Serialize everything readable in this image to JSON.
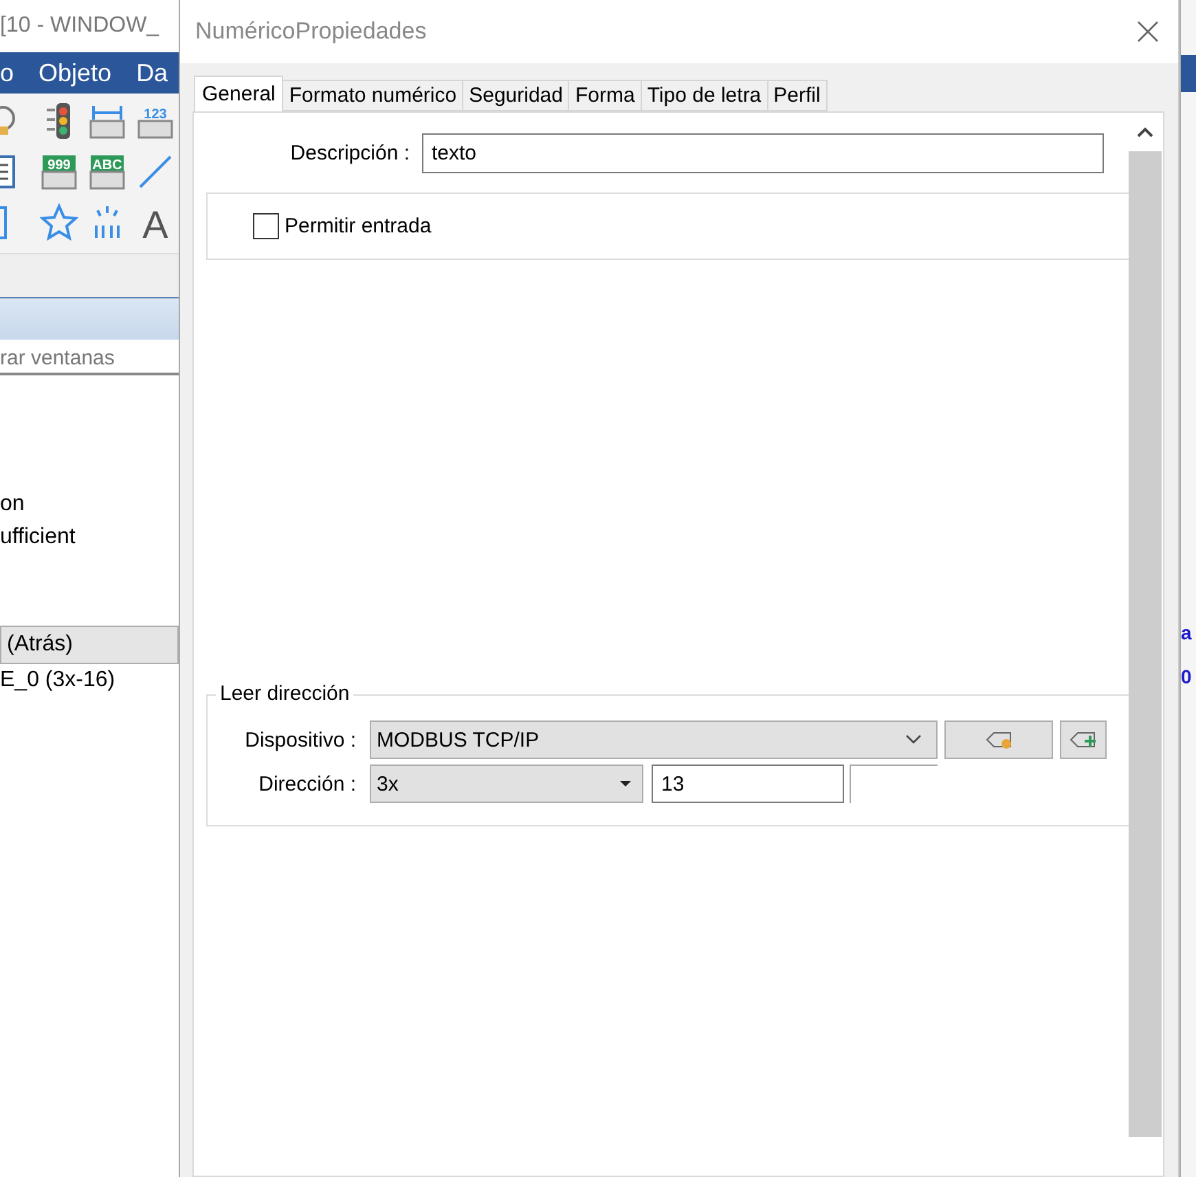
{
  "background_app": {
    "title": "[10 - WINDOW_",
    "menu": [
      "o",
      "Objeto",
      "Da"
    ],
    "toolbar": [
      [
        {
          "kind": "bulb"
        },
        {
          "kind": "traffic"
        },
        {
          "kind": "bar"
        },
        {
          "kind": "num",
          "label": "123"
        }
      ],
      [
        {
          "kind": "list"
        },
        {
          "kind": "numgreen",
          "label": "999"
        },
        {
          "kind": "numgreen",
          "label": "ABC"
        },
        {
          "kind": "line"
        }
      ],
      [
        {
          "kind": "rect"
        },
        {
          "kind": "star"
        },
        {
          "kind": "sparkle"
        },
        {
          "kind": "letter",
          "label": "A"
        }
      ]
    ],
    "search": {
      "placeholder": "rar ventanas"
    },
    "items": [
      {
        "label": "on",
        "selected": false
      },
      {
        "label": "ufficient",
        "selected": false
      },
      {
        "label": "(Atrás)",
        "selected": true
      },
      {
        "label": "E_0 (3x-16)",
        "selected": false
      }
    ],
    "right_edge": [
      "a",
      "0"
    ]
  },
  "dialog": {
    "title": "NuméricoPropiedades",
    "tabs": [
      {
        "label": "General",
        "selected": true
      },
      {
        "label": "Formato numérico",
        "selected": false
      },
      {
        "label": "Seguridad",
        "selected": false
      },
      {
        "label": "Forma",
        "selected": false
      },
      {
        "label": "Tipo de letra",
        "selected": false
      },
      {
        "label": "Perfil",
        "selected": false
      }
    ],
    "description": {
      "label": "Descripción :",
      "value": "texto"
    },
    "allow_input": {
      "label": "Permitir entrada",
      "checked": false
    },
    "read_address": {
      "title": "Leer dirección",
      "device": {
        "label": "Dispositivo :",
        "value": "MODBUS TCP/IP"
      },
      "address": {
        "label": "Dirección :",
        "type": "3x",
        "value": "13"
      }
    }
  }
}
